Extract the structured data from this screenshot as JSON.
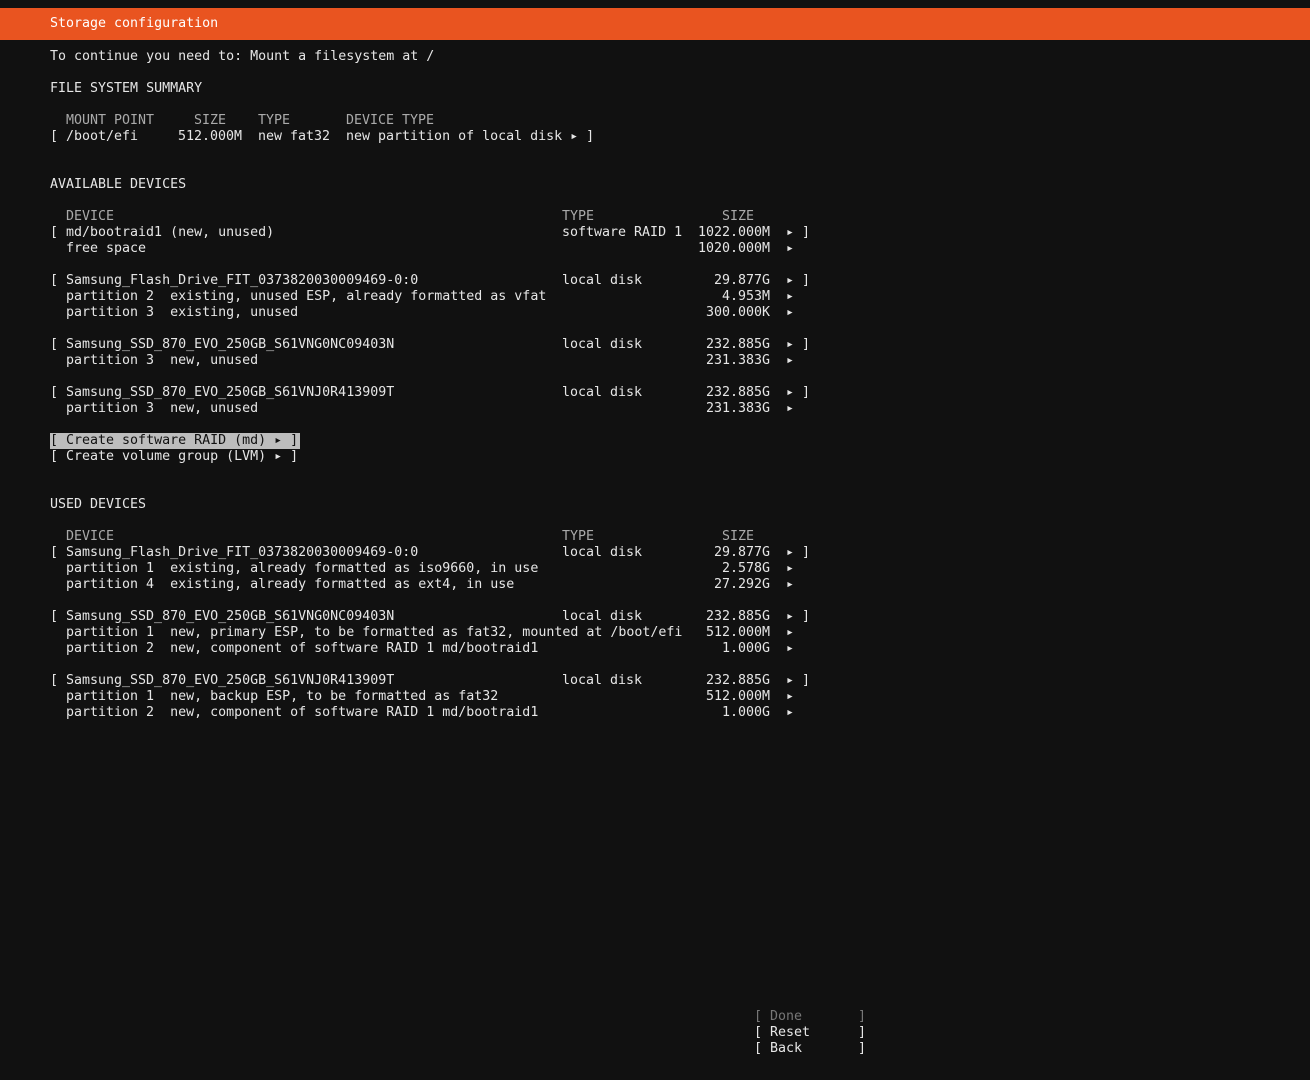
{
  "header": {
    "title": "Storage configuration"
  },
  "message": "To continue you need to: Mount a filesystem at /",
  "fs_summary": {
    "heading": "FILE SYSTEM SUMMARY",
    "columns": {
      "mount_point": "MOUNT POINT",
      "size": "SIZE",
      "type": "TYPE",
      "device_type": "DEVICE TYPE"
    },
    "rows": [
      {
        "open": "[",
        "mount_point": "/boot/efi",
        "size": "512.000M",
        "type": "new fat32",
        "device_type": "new partition of local disk ▸ ]"
      }
    ]
  },
  "available": {
    "heading": "AVAILABLE DEVICES",
    "columns": {
      "device": "DEVICE",
      "type": "TYPE",
      "size": "SIZE"
    },
    "rows": [
      {
        "open": "[",
        "device": "md/bootraid1 (new, unused)",
        "type": "software RAID 1",
        "size": "1022.000M",
        "arrow": "▸",
        "close": "]"
      },
      {
        "device": "free space",
        "size": "1020.000M",
        "arrow": "▸"
      },
      {
        "open": "[",
        "device": "Samsung_Flash_Drive_FIT_0373820030009469-0:0",
        "type": "local disk",
        "size": "29.877G",
        "arrow": "▸",
        "close": "]"
      },
      {
        "device": "partition 2  existing, unused ESP, already formatted as vfat",
        "size": "4.953M",
        "arrow": "▸"
      },
      {
        "device": "partition 3  existing, unused",
        "size": "300.000K",
        "arrow": "▸"
      },
      {
        "open": "[",
        "device": "Samsung_SSD_870_EVO_250GB_S61VNG0NC09403N",
        "type": "local disk",
        "size": "232.885G",
        "arrow": "▸",
        "close": "]"
      },
      {
        "device": "partition 3  new, unused",
        "size": "231.383G",
        "arrow": "▸"
      },
      {
        "open": "[",
        "device": "Samsung_SSD_870_EVO_250GB_S61VNJ0R413909T",
        "type": "local disk",
        "size": "232.885G",
        "arrow": "▸",
        "close": "]"
      },
      {
        "device": "partition 3  new, unused",
        "size": "231.383G",
        "arrow": "▸"
      }
    ],
    "actions": {
      "create_raid": "[ Create software RAID (md) ▸ ]",
      "create_lvm": "[ Create volume group (LVM) ▸ ]"
    }
  },
  "used": {
    "heading": "USED DEVICES",
    "columns": {
      "device": "DEVICE",
      "type": "TYPE",
      "size": "SIZE"
    },
    "rows": [
      {
        "open": "[",
        "device": "Samsung_Flash_Drive_FIT_0373820030009469-0:0",
        "type": "local disk",
        "size": "29.877G",
        "arrow": "▸",
        "close": "]"
      },
      {
        "device": "partition 1  existing, already formatted as iso9660, in use",
        "size": "2.578G",
        "arrow": "▸"
      },
      {
        "device": "partition 4  existing, already formatted as ext4, in use",
        "size": "27.292G",
        "arrow": "▸"
      },
      {
        "open": "[",
        "device": "Samsung_SSD_870_EVO_250GB_S61VNG0NC09403N",
        "type": "local disk",
        "size": "232.885G",
        "arrow": "▸",
        "close": "]"
      },
      {
        "device": "partition 1  new, primary ESP, to be formatted as fat32, mounted at /boot/efi",
        "size": "512.000M",
        "arrow": "▸"
      },
      {
        "device": "partition 2  new, component of software RAID 1 md/bootraid1",
        "size": "1.000G",
        "arrow": "▸"
      },
      {
        "open": "[",
        "device": "Samsung_SSD_870_EVO_250GB_S61VNJ0R413909T",
        "type": "local disk",
        "size": "232.885G",
        "arrow": "▸",
        "close": "]"
      },
      {
        "device": "partition 1  new, backup ESP, to be formatted as fat32",
        "size": "512.000M",
        "arrow": "▸"
      },
      {
        "device": "partition 2  new, component of software RAID 1 md/bootraid1",
        "size": "1.000G",
        "arrow": "▸"
      }
    ]
  },
  "buttons": {
    "done": {
      "open": "[",
      "label": "Done",
      "close": "]"
    },
    "reset": {
      "open": "[",
      "label": "Reset",
      "close": "]"
    },
    "back": {
      "open": "[",
      "label": "Back",
      "close": "]"
    }
  }
}
